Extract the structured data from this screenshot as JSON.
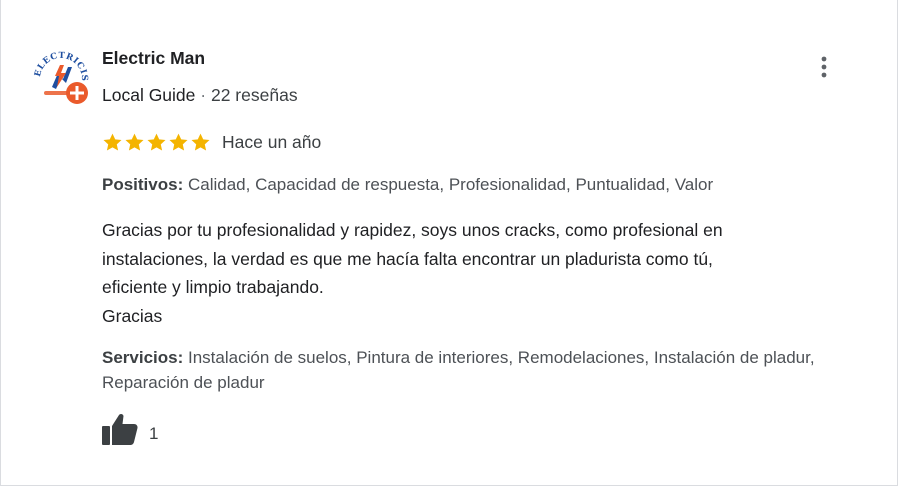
{
  "reviewer": {
    "name": "Electric Man",
    "guide_label": "Local Guide",
    "separator": "·",
    "reviews_count": "22 reseñas",
    "avatar_text": "ELECTRICISTA"
  },
  "review": {
    "rating": 5,
    "max_rating": 5,
    "star_color": "#f4b400",
    "time_ago": "Hace un año",
    "positives_label": "Positivos:",
    "positives_value": "Calidad, Capacidad de respuesta, Profesionalidad, Puntualidad, Valor",
    "text_lines": [
      "Gracias por tu profesionalidad y rapidez, soys unos cracks, como profesional en",
      "instalaciones, la verdad es que me hacía falta encontrar un pladurista como tú,",
      "eficiente y limpio trabajando.",
      "Gracias"
    ],
    "services_label": "Servicios:",
    "services_value": "Instalación de suelos, Pintura de interiores, Remodelaciones, Instalación de pladur, Reparación de pladur",
    "likes": "1"
  },
  "icons": {
    "menu": "more-vert-icon",
    "like": "thumb-up-icon",
    "star": "star-icon"
  },
  "colors": {
    "accent_orange": "#ea5a2b",
    "avatar_blue": "#1f4fa0"
  }
}
